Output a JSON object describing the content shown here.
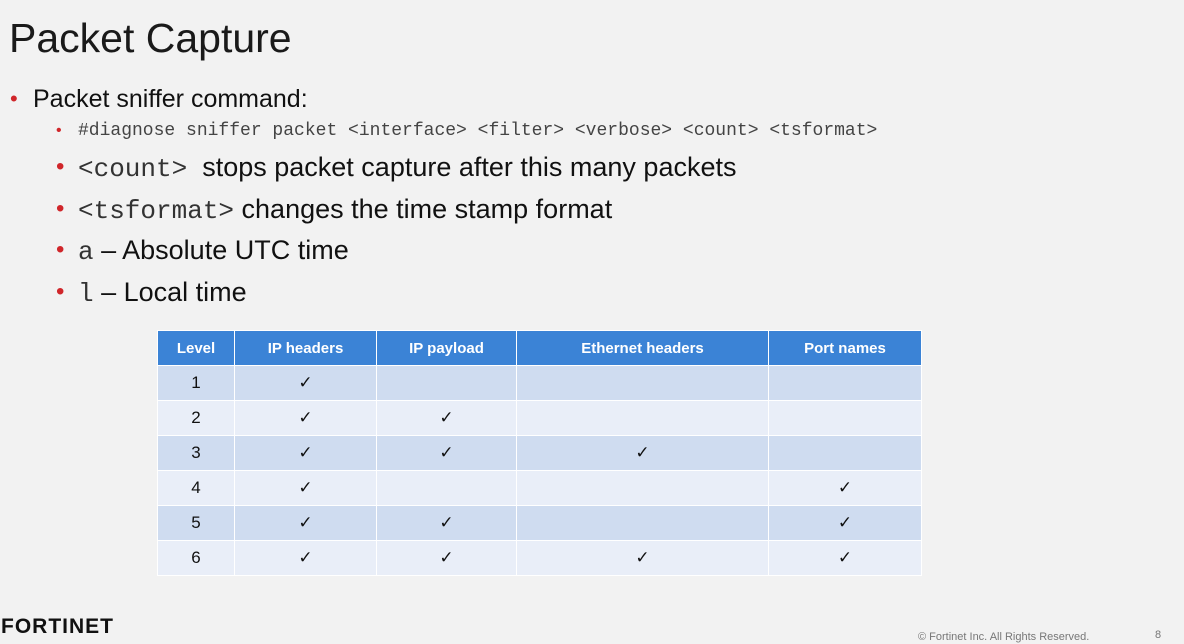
{
  "title": "Packet Capture",
  "bullet_main": "Packet sniffer command:",
  "sub_bullets": {
    "command": "#diagnose sniffer packet <interface> <filter> <verbose> <count> <tsformat>",
    "count": {
      "code": "<count>",
      "text": "  stops packet capture after this many packets"
    },
    "tsformat": {
      "code": "<tsformat>",
      "text": " changes the time stamp format"
    },
    "absolute": {
      "code": "a",
      "text": " – Absolute UTC time"
    },
    "local": {
      "code": "l",
      "text": " – Local time"
    }
  },
  "table": {
    "headers": [
      "Level",
      "IP headers",
      "IP payload",
      "Ethernet headers",
      "Port names"
    ],
    "rows": [
      [
        "1",
        "✓",
        "",
        "",
        ""
      ],
      [
        "2",
        "✓",
        "✓",
        "",
        ""
      ],
      [
        "3",
        "✓",
        "✓",
        "✓",
        ""
      ],
      [
        "4",
        "✓",
        "",
        "",
        "✓"
      ],
      [
        "5",
        "✓",
        "✓",
        "",
        "✓"
      ],
      [
        "6",
        "✓",
        "✓",
        "✓",
        "✓"
      ]
    ]
  },
  "footer": {
    "logo": "FORTINET",
    "copyright": "© Fortinet Inc. All Rights Reserved.",
    "page": "8"
  },
  "colors": {
    "accent_red": "#d0262a",
    "header_blue": "#3b83d6"
  }
}
